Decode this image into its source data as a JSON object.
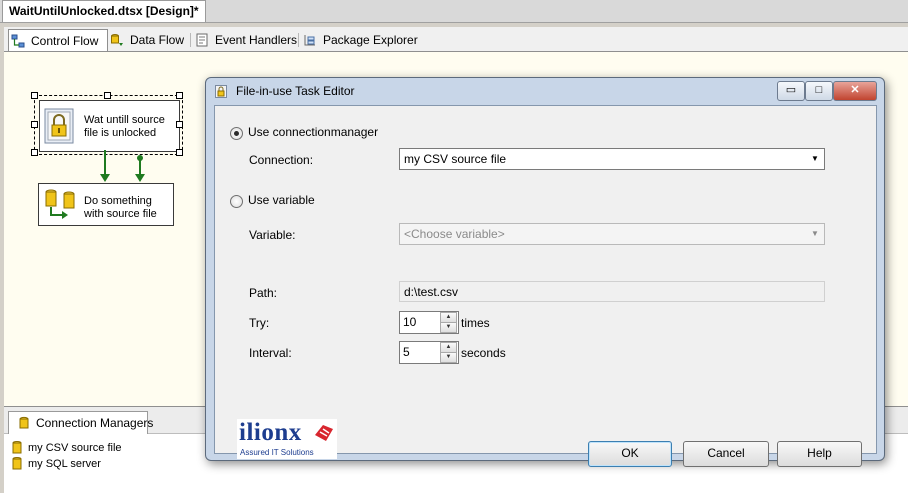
{
  "document_tab": {
    "title": "WaitUntilUnlocked.dtsx [Design]*"
  },
  "designer_tabs": [
    {
      "label": "Control Flow",
      "icon": "control-flow-icon",
      "active": true
    },
    {
      "label": "Data Flow",
      "icon": "data-flow-icon"
    },
    {
      "label": "Event Handlers",
      "icon": "event-handlers-icon"
    },
    {
      "label": "Package Explorer",
      "icon": "package-explorer-icon"
    }
  ],
  "tasks": {
    "file_in_use": {
      "label_line1": "Wat untill source",
      "label_line2": "file is unlocked",
      "icon": "lock-icon"
    },
    "do_something": {
      "label_line1": "Do something",
      "label_line2": "with source file",
      "icon": "database-transfer-icon"
    }
  },
  "connection_managers": {
    "tab_label": "Connection Managers",
    "items": [
      {
        "label": "my CSV source file",
        "icon": "database-icon"
      },
      {
        "label": "my SQL server",
        "icon": "database-icon"
      }
    ]
  },
  "dialog": {
    "title": "File-in-use Task Editor",
    "caption_buttons": {
      "minimize": "▭",
      "maximize": "□",
      "close": "✕"
    },
    "use_connectionmanager_label": "Use connectionmanager",
    "use_connectionmanager_selected": true,
    "connection_label": "Connection:",
    "connection_value": "my CSV source file",
    "use_variable_label": "Use variable",
    "variable_label": "Variable:",
    "variable_value": "<Choose variable>",
    "path_label": "Path:",
    "path_value": "d:\\test.csv",
    "try_label": "Try:",
    "try_value": "10",
    "try_unit": "times",
    "interval_label": "Interval:",
    "interval_value": "5",
    "interval_unit": "seconds",
    "logo": {
      "brand": "ilionx",
      "tagline": "Assured IT Solutions"
    },
    "buttons": {
      "ok": "OK",
      "cancel": "Cancel",
      "help": "Help"
    }
  },
  "colors": {
    "accent_blue": "#3c7fb1",
    "brand_red": "#d8262f",
    "brand_navy": "#1d3d8f",
    "success_arrow": "#1f7a1f"
  }
}
